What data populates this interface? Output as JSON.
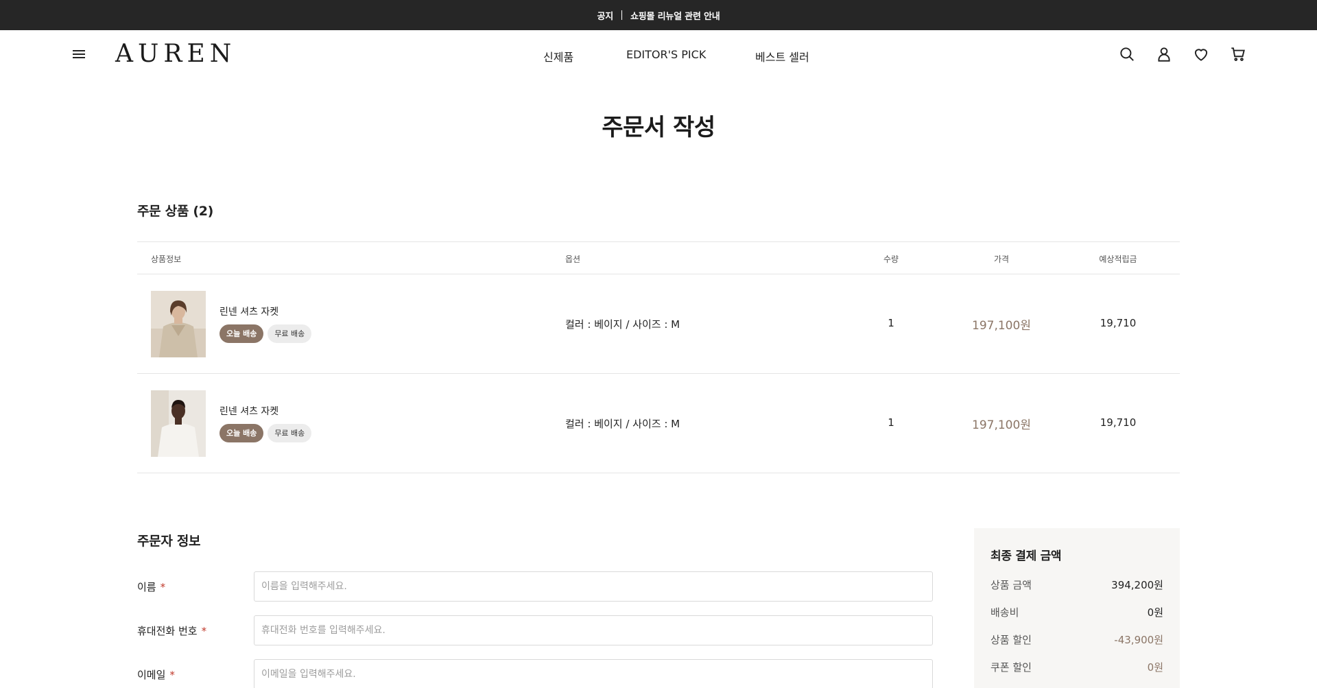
{
  "notice": {
    "label": "공지",
    "text": "쇼핑몰 리뉴얼 관련 안내"
  },
  "header": {
    "logo": "AUREN",
    "nav": [
      "신제품",
      "EDITOR'S PICK",
      "베스트 셀러"
    ]
  },
  "page_title": "주문서 작성",
  "order_items": {
    "title": "주문 상품 (2)",
    "columns": [
      "상품정보",
      "옵션",
      "수량",
      "가격",
      "예상적립금"
    ],
    "rows": [
      {
        "name": "린넨 셔츠 자켓",
        "tags": [
          "오늘 배송",
          "무료 배송"
        ],
        "option": "컬러 : 베이지 / 사이즈 : M",
        "qty": "1",
        "price": "197,100원",
        "point": "19,710"
      },
      {
        "name": "린넨 셔츠 자켓",
        "tags": [
          "오늘 배송",
          "무료 배송"
        ],
        "option": "컬러 : 베이지 / 사이즈 : M",
        "qty": "1",
        "price": "197,100원",
        "point": "19,710"
      }
    ]
  },
  "orderer": {
    "title": "주문자 정보",
    "fields": [
      {
        "label": "이름",
        "required": "*",
        "placeholder": "이름을 입력해주세요."
      },
      {
        "label": "휴대전화 번호",
        "required": "*",
        "placeholder": "휴대전화 번호를 입력해주세요."
      },
      {
        "label": "이메일",
        "required": "*",
        "placeholder": "이메일을 입력해주세요."
      }
    ]
  },
  "summary": {
    "title": "최종 결제 금액",
    "rows": [
      {
        "label": "상품 금액",
        "value": "394,200원"
      },
      {
        "label": "배송비",
        "value": "0원"
      },
      {
        "label": "상품 할인",
        "value": "-43,900원"
      },
      {
        "label": "쿠폰 할인",
        "value": "0원"
      }
    ]
  },
  "colors": {
    "accent": "#8b7566",
    "notice_bg": "#262626",
    "required": "#c0392b"
  }
}
